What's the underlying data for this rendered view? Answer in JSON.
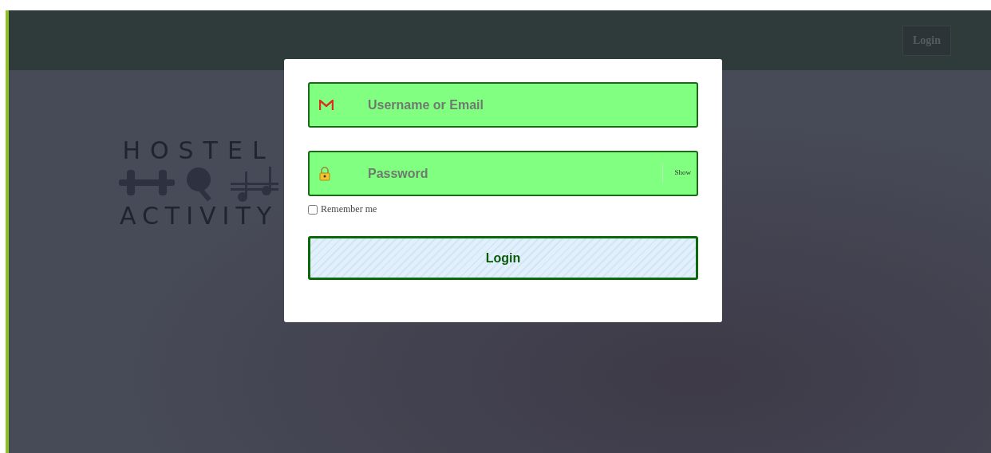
{
  "navbar": {
    "login_button": "Login"
  },
  "logo": {
    "line_1": "HOSTEL",
    "line_2": "ACTIVITY"
  },
  "login_dialog": {
    "username": {
      "placeholder": "Username or Email"
    },
    "password": {
      "placeholder": "Password",
      "toggle": "Show"
    },
    "remember": {
      "label": "Remember me",
      "checked": false
    },
    "submit": "Login"
  }
}
